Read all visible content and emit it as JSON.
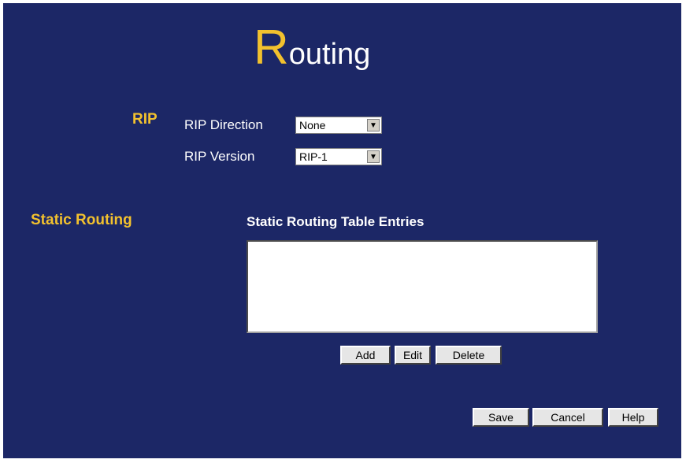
{
  "title": {
    "first_letter": "R",
    "rest": "outing"
  },
  "rip": {
    "section_label": "RIP",
    "direction_label": "RIP Direction",
    "direction_value": "None",
    "version_label": "RIP Version",
    "version_value": "RIP-1"
  },
  "static_routing": {
    "section_label": "Static Routing",
    "table_heading": "Static Routing Table Entries",
    "entries": [],
    "add_label": "Add",
    "edit_label": "Edit",
    "delete_label": "Delete"
  },
  "footer": {
    "save_label": "Save",
    "cancel_label": "Cancel",
    "help_label": "Help"
  },
  "colors": {
    "background": "#1c2766",
    "accent": "#f2c12e",
    "text": "#ffffff"
  }
}
